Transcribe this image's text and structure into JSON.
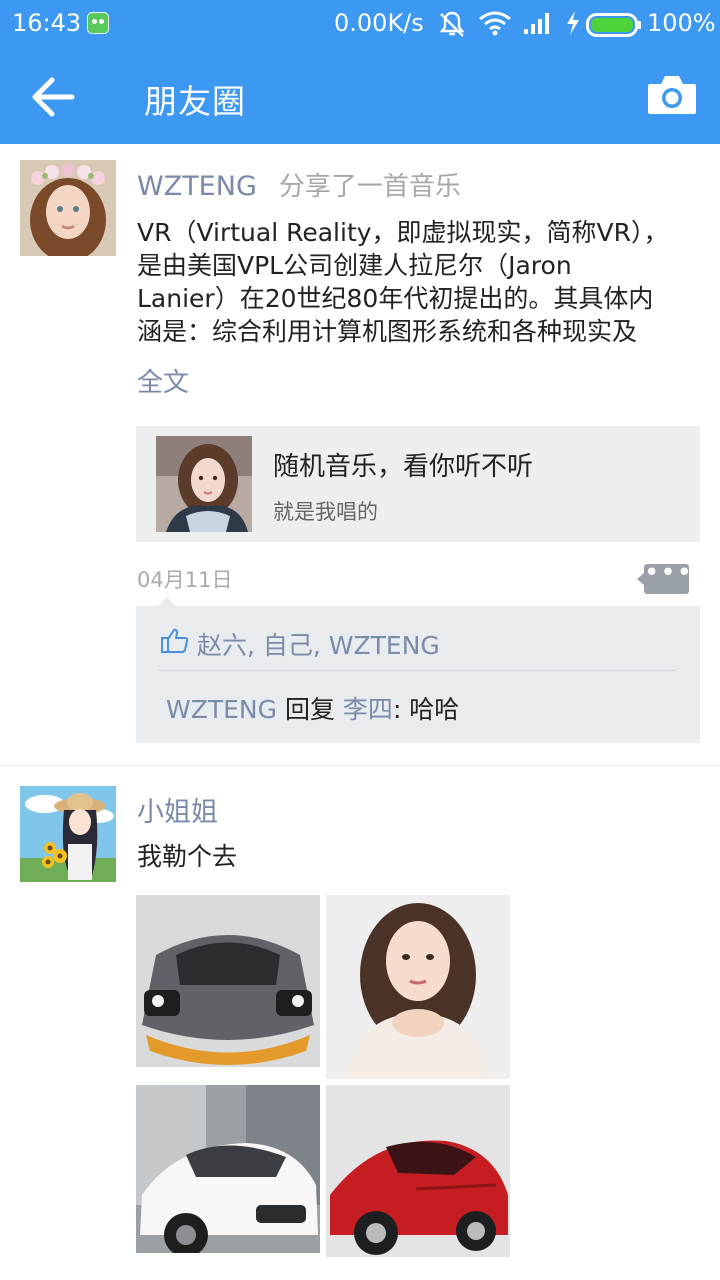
{
  "status_bar": {
    "time": "16:43",
    "net_speed": "0.00K/s",
    "battery": "100%"
  },
  "header": {
    "title": "朋友圈",
    "back_icon": "arrow-left-icon",
    "camera_icon": "camera-icon"
  },
  "colors": {
    "primary": "#3d98f1",
    "link": "#7a8aa8",
    "comment_bg": "#e9ecef",
    "card_bg": "#eeeeee"
  },
  "posts": [
    {
      "name": "WZTENG",
      "action": "分享了一首音乐",
      "text_lines": [
        "VR（Virtual Reality，即虚拟现实，简称VR），",
        "是由美国VPL公司创建人拉尼尔（Jaron",
        "Lanier）在20世纪80年代初提出的。其具体内",
        "涵是：综合利用计算机图形系统和各种现实及"
      ],
      "full_text_link": "全文",
      "music": {
        "title": "随机音乐，看你听不听",
        "subtitle": "就是我唱的"
      },
      "date": "04月11日",
      "more_label": "•••",
      "likes": "赵六, 自己, WZTENG",
      "comment": {
        "user": "WZTENG",
        "reply_word": "回复",
        "target": "李四",
        "text": ": 哈哈"
      }
    },
    {
      "name": "小姐姐",
      "text": "我勒个去",
      "photo_count": 4
    }
  ]
}
